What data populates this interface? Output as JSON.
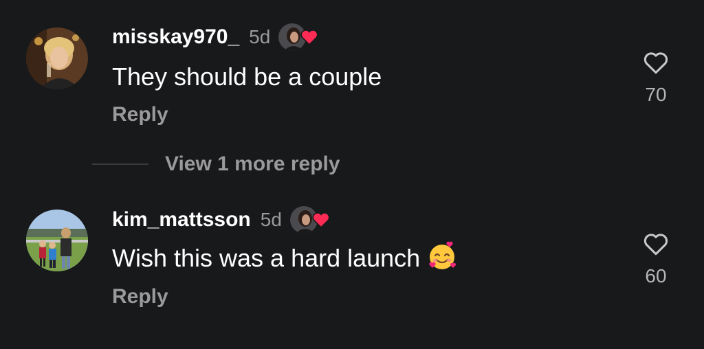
{
  "comments": [
    {
      "username": "misskay970_",
      "time": "5d",
      "text": "They should be a couple",
      "reply_label": "Reply",
      "like_count": "70",
      "has_emoji": false
    },
    {
      "username": "kim_mattsson",
      "time": "5d",
      "text": "Wish this was a hard launch",
      "emoji_icon": "smiling-face-with-hearts-icon",
      "reply_label": "Reply",
      "like_count": "60",
      "has_emoji": true
    }
  ],
  "replies_toggle": {
    "label": "View 1 more reply"
  },
  "colors": {
    "background": "#18191b",
    "text": "#ffffff",
    "muted": "#9a9a9d",
    "heart": "#fe2c55"
  }
}
